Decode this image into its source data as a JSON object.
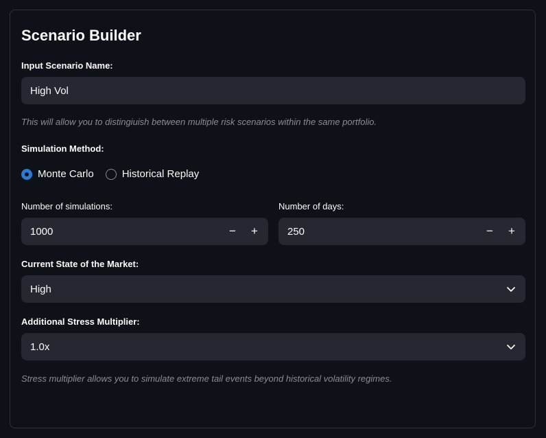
{
  "title": "Scenario Builder",
  "scenario_name": {
    "label": "Input Scenario Name:",
    "value": "High Vol",
    "help": "This will allow you to distingiuish between multiple risk scenarios within the same portfolio."
  },
  "simulation_method": {
    "label": "Simulation Method:",
    "options": [
      "Monte Carlo",
      "Historical Replay"
    ],
    "selected": "Monte Carlo"
  },
  "num_simulations": {
    "label": "Number of simulations:",
    "value": "1000",
    "minus": "−",
    "plus": "+"
  },
  "num_days": {
    "label": "Number of days:",
    "value": "250",
    "minus": "−",
    "plus": "+"
  },
  "market_state": {
    "label": "Current State of the Market:",
    "value": "High"
  },
  "stress_multiplier": {
    "label": "Additional Stress Multiplier:",
    "value": "1.0x",
    "help": "Stress multiplier allows you to simulate extreme tail events beyond historical volatility regimes."
  },
  "colors": {
    "background": "#0e1117",
    "field": "#262730",
    "accent": "#2b7cd3",
    "help_text": "#8b8d95"
  },
  "icons": {
    "select": "chevron-down-icon",
    "radio_on": "radio-selected-icon",
    "radio_off": "radio-unselected-icon"
  }
}
